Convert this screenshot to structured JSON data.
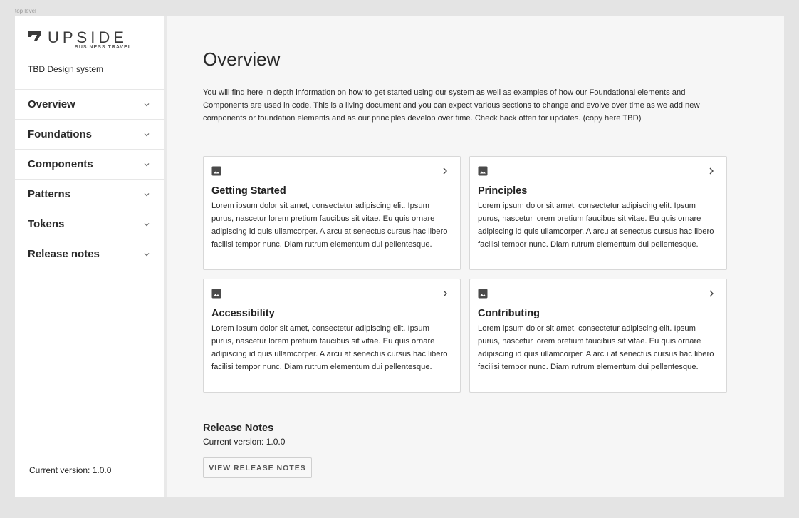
{
  "frame_label": "top level",
  "brand": {
    "logo_word": "UPSIDE",
    "logo_sub": "BUSINESS TRAVEL",
    "design_system": "TBD Design system"
  },
  "nav": {
    "items": [
      {
        "label": "Overview"
      },
      {
        "label": "Foundations"
      },
      {
        "label": "Components"
      },
      {
        "label": "Patterns"
      },
      {
        "label": "Tokens"
      },
      {
        "label": "Release notes"
      }
    ]
  },
  "sidebar_version": "Current version: 1.0.0",
  "main": {
    "title": "Overview",
    "intro": "You will find here in depth information on how to get started using our system as well as examples of how our Foundational elements and Components are used in code. This is a living document and you can expect various sections to change and evolve over time as we add new components or foundation elements and as our principles develop over time. Check back often for updates. (copy here TBD)",
    "cards": [
      {
        "title": "Getting Started",
        "body": "Lorem ipsum dolor sit amet, consectetur adipiscing elit. Ipsum purus, nascetur lorem pretium faucibus sit vitae. Eu quis ornare adipiscing id quis ullamcorper. A arcu at senectus cursus hac libero facilisi tempor nunc. Diam rutrum elementum dui pellentesque."
      },
      {
        "title": "Principles",
        "body": "Lorem ipsum dolor sit amet, consectetur adipiscing elit. Ipsum purus, nascetur lorem pretium faucibus sit vitae. Eu quis ornare adipiscing id quis ullamcorper. A arcu at senectus cursus hac libero facilisi tempor nunc. Diam rutrum elementum dui pellentesque."
      },
      {
        "title": "Accessibility",
        "body": "Lorem ipsum dolor sit amet, consectetur adipiscing elit. Ipsum purus, nascetur lorem pretium faucibus sit vitae. Eu quis ornare adipiscing id quis ullamcorper. A arcu at senectus cursus hac libero facilisi tempor nunc. Diam rutrum elementum dui pellentesque."
      },
      {
        "title": "Contributing",
        "body": "Lorem ipsum dolor sit amet, consectetur adipiscing elit. Ipsum purus, nascetur lorem pretium faucibus sit vitae. Eu quis ornare adipiscing id quis ullamcorper. A arcu at senectus cursus hac libero facilisi tempor nunc. Diam rutrum elementum dui pellentesque."
      }
    ],
    "release_notes": {
      "title": "Release Notes",
      "version": "Current version: 1.0.0",
      "button_label": "VIEW RELEASE NOTES"
    }
  },
  "icons": {
    "nav_chevron": "chevron-down-icon",
    "card_image": "image-icon",
    "card_arrow": "chevron-right-icon",
    "logo": "upside-logo-mark"
  },
  "colors": {
    "page_bg": "#e4e4e4",
    "content_bg": "#f6f6f6",
    "sidebar_bg": "#ffffff",
    "text": "#2a2a2a"
  }
}
